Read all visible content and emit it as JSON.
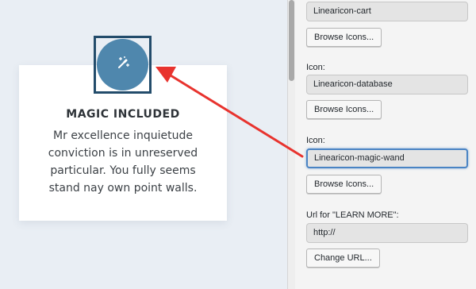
{
  "preview": {
    "card": {
      "title": "MAGIC INCLUDED",
      "lines": [
        "Mr excellence inquietude",
        "conviction is in unreserved",
        "particular. You fully seems",
        "stand nay own point walls."
      ],
      "icon": "magic-wand-icon",
      "icon_color": "#4f87ad"
    },
    "annotation_arrow_color": "#e8332e"
  },
  "settings": {
    "fields": [
      {
        "label": "",
        "value": "Linearicon-cart",
        "button": "Browse Icons..."
      },
      {
        "label": "Icon:",
        "value": "Linearicon-database",
        "button": "Browse Icons..."
      },
      {
        "label": "Icon:",
        "value": "Linearicon-magic-wand",
        "button": "Browse Icons..."
      },
      {
        "label": "Url for \"LEARN MORE\":",
        "value": "http://",
        "button": "Change URL..."
      }
    ]
  }
}
